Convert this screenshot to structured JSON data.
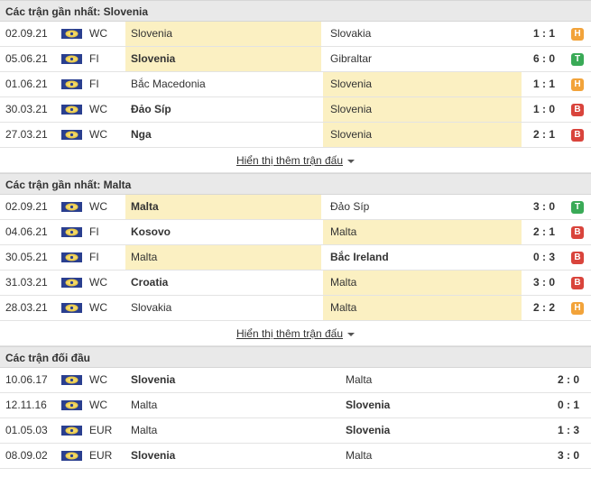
{
  "colors": {
    "H": "#f2a33a",
    "T": "#3aaa57",
    "B": "#d9443c",
    "highlight": "#fbf0c2"
  },
  "sections": [
    {
      "title": "Các trận gần nhất: Slovenia",
      "rows": [
        {
          "date": "02.09.21",
          "comp": "WC",
          "home": "Slovenia",
          "away": "Slovakia",
          "score": "1 : 1",
          "result": "H",
          "highlight": "home",
          "bold": ""
        },
        {
          "date": "05.06.21",
          "comp": "FI",
          "home": "Slovenia",
          "away": "Gibraltar",
          "score": "6 : 0",
          "result": "T",
          "highlight": "home",
          "bold": "home"
        },
        {
          "date": "01.06.21",
          "comp": "FI",
          "home": "Bắc Macedonia",
          "away": "Slovenia",
          "score": "1 : 1",
          "result": "H",
          "highlight": "away",
          "bold": ""
        },
        {
          "date": "30.03.21",
          "comp": "WC",
          "home": "Đảo Síp",
          "away": "Slovenia",
          "score": "1 : 0",
          "result": "B",
          "highlight": "away",
          "bold": "home"
        },
        {
          "date": "27.03.21",
          "comp": "WC",
          "home": "Nga",
          "away": "Slovenia",
          "score": "2 : 1",
          "result": "B",
          "highlight": "away",
          "bold": "home"
        }
      ],
      "more": "Hiển thị thêm trận đấu"
    },
    {
      "title": "Các trận gần nhất: Malta",
      "rows": [
        {
          "date": "02.09.21",
          "comp": "WC",
          "home": "Malta",
          "away": "Đảo Síp",
          "score": "3 : 0",
          "result": "T",
          "highlight": "home",
          "bold": "home"
        },
        {
          "date": "04.06.21",
          "comp": "FI",
          "home": "Kosovo",
          "away": "Malta",
          "score": "2 : 1",
          "result": "B",
          "highlight": "away",
          "bold": "home"
        },
        {
          "date": "30.05.21",
          "comp": "FI",
          "home": "Malta",
          "away": "Bắc Ireland",
          "score": "0 : 3",
          "result": "B",
          "highlight": "home",
          "bold": "away"
        },
        {
          "date": "31.03.21",
          "comp": "WC",
          "home": "Croatia",
          "away": "Malta",
          "score": "3 : 0",
          "result": "B",
          "highlight": "away",
          "bold": "home"
        },
        {
          "date": "28.03.21",
          "comp": "WC",
          "home": "Slovakia",
          "away": "Malta",
          "score": "2 : 2",
          "result": "H",
          "highlight": "away",
          "bold": ""
        }
      ],
      "more": "Hiển thị thêm trận đấu"
    }
  ],
  "h2h": {
    "title": "Các trận đối đầu",
    "rows": [
      {
        "date": "10.06.17",
        "comp": "WC",
        "home": "Slovenia",
        "away": "Malta",
        "score": "2 : 0",
        "bold": "home"
      },
      {
        "date": "12.11.16",
        "comp": "WC",
        "home": "Malta",
        "away": "Slovenia",
        "score": "0 : 1",
        "bold": "away"
      },
      {
        "date": "01.05.03",
        "comp": "EUR",
        "home": "Malta",
        "away": "Slovenia",
        "score": "1 : 3",
        "bold": "away"
      },
      {
        "date": "08.09.02",
        "comp": "EUR",
        "home": "Slovenia",
        "away": "Malta",
        "score": "3 : 0",
        "bold": "home"
      }
    ]
  }
}
